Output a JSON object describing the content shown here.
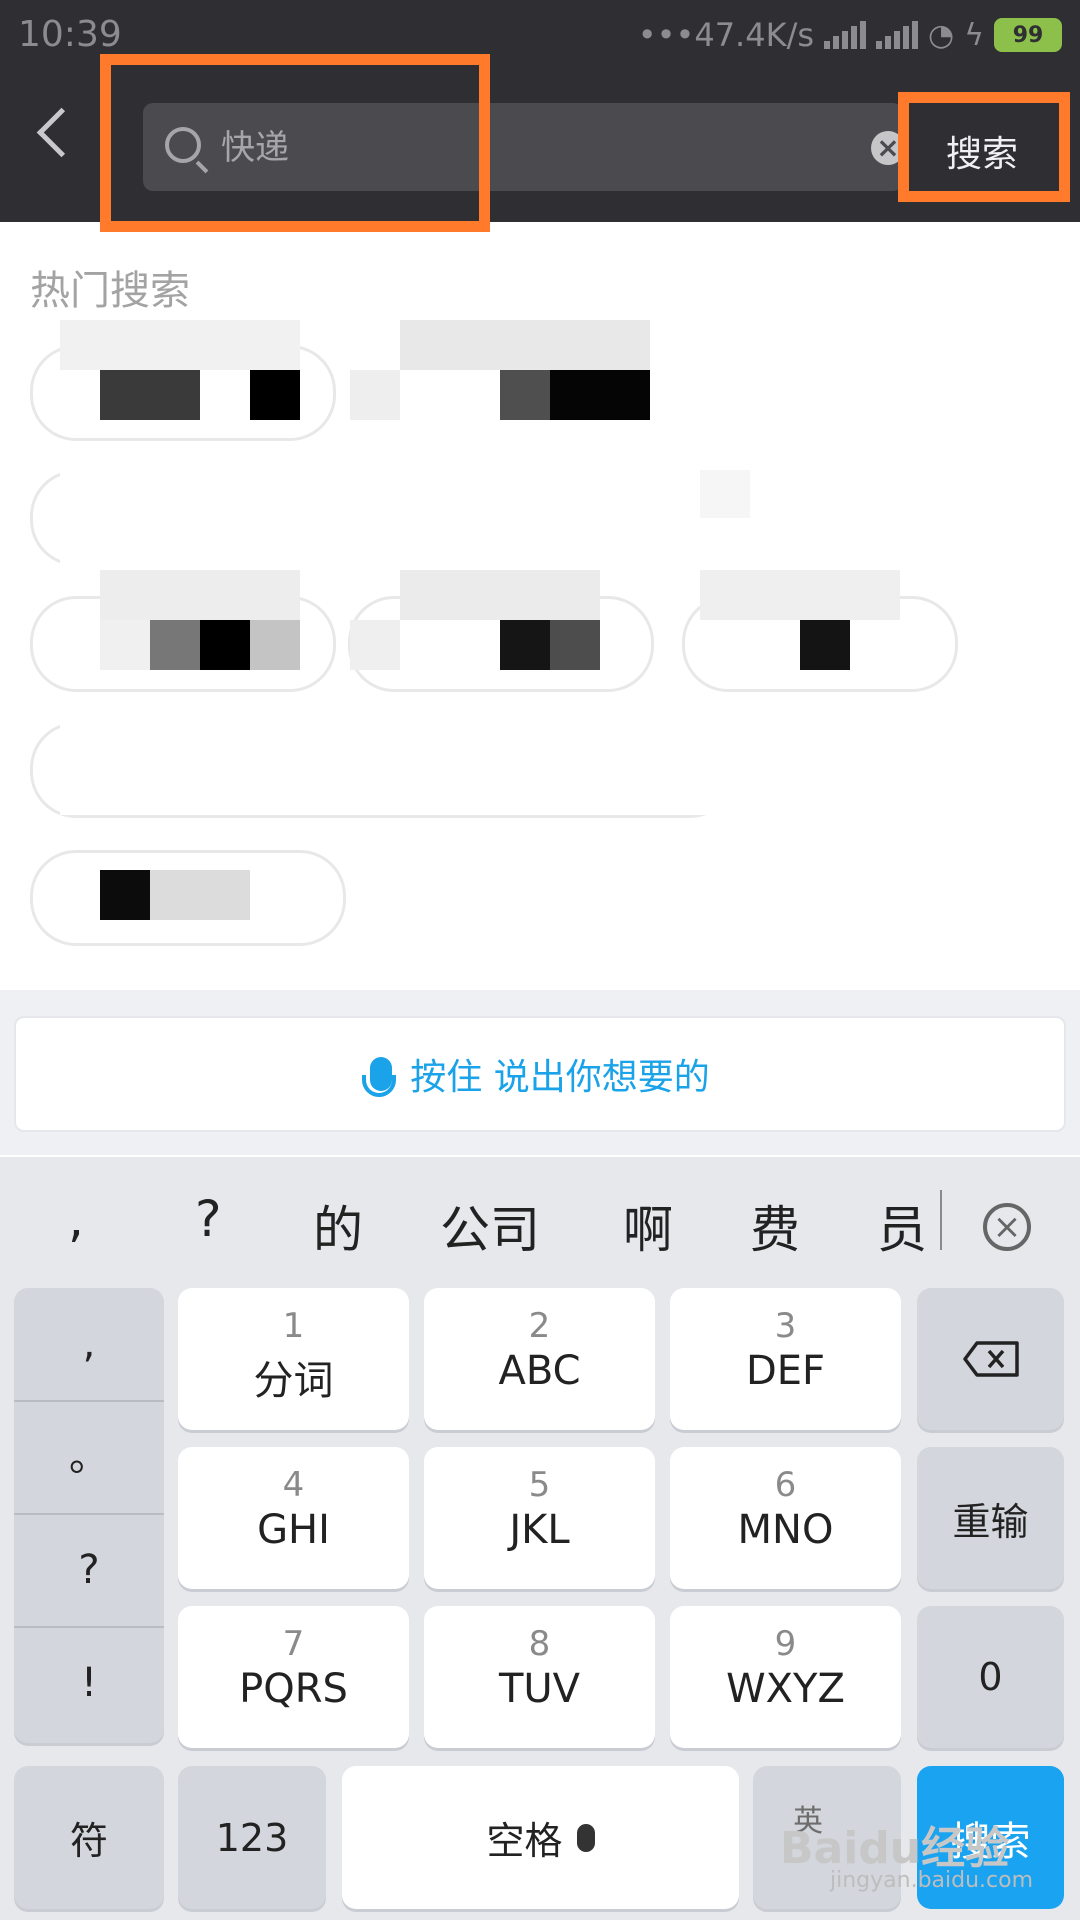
{
  "status_bar": {
    "time": "10:39",
    "net_speed": "•••47.4K/s",
    "battery": "99"
  },
  "header": {
    "search_placeholder": "快递",
    "search_button": "搜索"
  },
  "hot": {
    "title": "热门搜索"
  },
  "voice": {
    "label": "按住 说出你想要的"
  },
  "keyboard": {
    "candidates": [
      ",",
      "?",
      "的",
      "公司",
      "啊",
      "费",
      "员"
    ],
    "keys": [
      {
        "num": "1",
        "label": "分词"
      },
      {
        "num": "2",
        "label": "ABC"
      },
      {
        "num": "3",
        "label": "DEF"
      },
      {
        "num": "4",
        "label": "GHI"
      },
      {
        "num": "5",
        "label": "JKL"
      },
      {
        "num": "6",
        "label": "MNO"
      },
      {
        "num": "7",
        "label": "PQRS"
      },
      {
        "num": "8",
        "label": "TUV"
      },
      {
        "num": "9",
        "label": "WXYZ"
      }
    ],
    "punct": [
      ",",
      "。",
      "?",
      "!"
    ],
    "reinput": "重输",
    "zero": "0",
    "symbol": "符",
    "numbers": "123",
    "space": "空格",
    "lang": "英",
    "enter": "搜索"
  },
  "watermark": {
    "brand": "Baidu经验",
    "url": "jingyan.baidu.com"
  },
  "colors": {
    "header_bg": "#2f2f33",
    "highlight": "#ff7a2a",
    "accent_blue": "#1aa3f0"
  }
}
